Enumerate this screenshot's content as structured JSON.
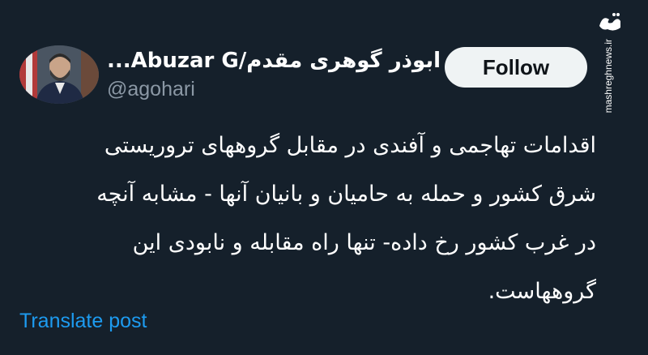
{
  "author": {
    "display_name": "ابوذر گوهری مقدم/Abuzar G...",
    "handle": "@agohari"
  },
  "follow_label": "Follow",
  "tweet": {
    "lines": [
      "اقدامات تهاجمی و آفندی در مقابل گروههای تروریستی",
      "شرق کشور و حمله به حامیان و بانیان آنها - مشابه آنچه",
      "در غرب کشور رخ داده- تنها راه مقابله و نابودی این",
      "گروههاست."
    ]
  },
  "translate_label": "Translate post",
  "watermark": {
    "logo_text": "مشرق",
    "site": "mashreghnews.ir"
  },
  "colors": {
    "background": "#15202b",
    "link": "#1d9bf0",
    "handle": "#8b98a5",
    "button_bg": "#eff3f4"
  }
}
